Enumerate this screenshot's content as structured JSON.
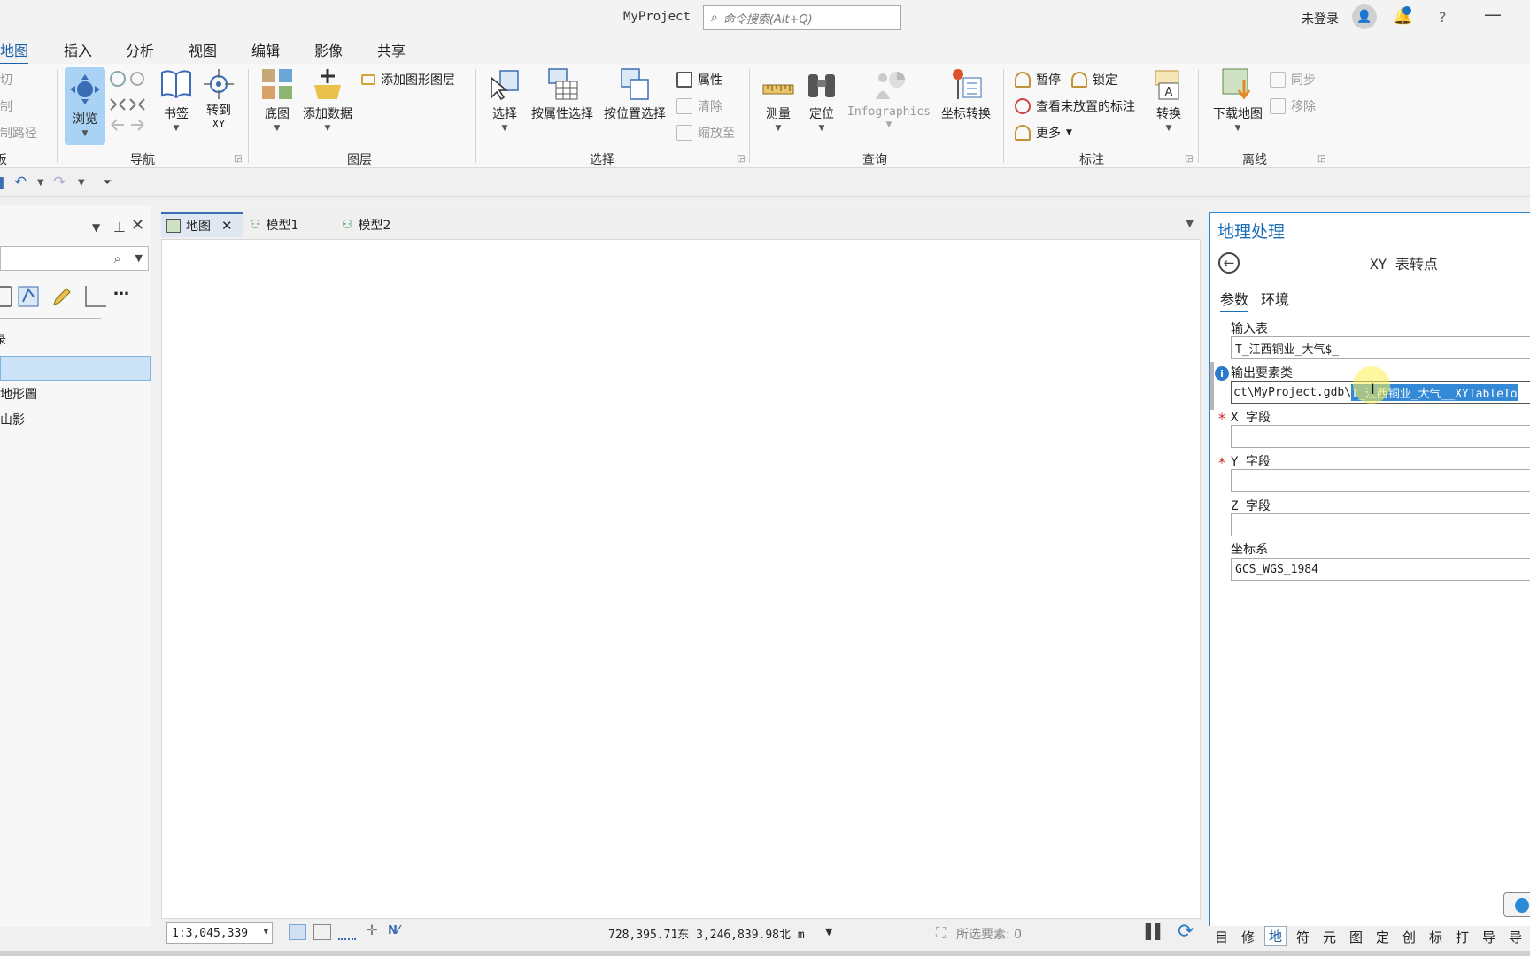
{
  "titlebar": {
    "app_title": "MyProject",
    "search_placeholder": "命令搜索(Alt+Q)",
    "login": "未登录"
  },
  "menu_tabs": [
    "地图",
    "插入",
    "分析",
    "视图",
    "编辑",
    "影像",
    "共享"
  ],
  "ribbon": {
    "clipboard": {
      "cut": "剪切",
      "copy": "复制",
      "copy_path": "复制路径",
      "group": "板"
    },
    "navigate": {
      "explore": "浏览",
      "bookmarks": "书签",
      "goto_xy_line1": "转到",
      "goto_xy_line2": "XY",
      "group": "导航"
    },
    "layer": {
      "basemap": "底图",
      "add_data": "添加数据",
      "add_graphics_layer": "添加图形图层",
      "group": "图层"
    },
    "selection": {
      "select": "选择",
      "select_by_attr": "按属性选择",
      "select_by_loc": "按位置选择",
      "attributes": "属性",
      "clear": "清除",
      "zoom_to": "缩放至",
      "group": "选择"
    },
    "inquiry": {
      "measure": "测量",
      "locate": "定位",
      "infographics": "Infographics",
      "coord_convert": "坐标转换",
      "group": "查询"
    },
    "labeling": {
      "pause": "暂停",
      "lock": "锁定",
      "view_unplaced": "查看未放置的标注",
      "more": "更多",
      "convert": "转换",
      "group": "标注"
    },
    "offline": {
      "download_map": "下载地图",
      "sync": "同步",
      "remove": "移除",
      "group": "离线"
    }
  },
  "contents": {
    "header_partial": "录",
    "layers": [
      "",
      "地形圖",
      "山影"
    ]
  },
  "view_tabs": [
    {
      "label": "地图",
      "active": true
    },
    {
      "label": "模型1",
      "active": false
    },
    {
      "label": "模型2",
      "active": false
    }
  ],
  "statusbar": {
    "scale": "1:3,045,339",
    "coordinates": "728,395.71东 3,246,839.98北 m",
    "selected_features": "所选要素: 0"
  },
  "geoprocessing": {
    "pane_title": "地理处理",
    "tool_name": "XY 表转点",
    "tabs": [
      "参数",
      "环境"
    ],
    "params": {
      "input_table_label": "输入表",
      "input_table_value": "T_江西铜业_大气$_",
      "output_fc_label": "输出要素类",
      "output_fc_value_plain": "ct\\MyProject.gdb\\",
      "output_fc_value_selected": "T_江西铜业_大气__XYTableTo",
      "x_field_label": "X 字段",
      "x_field_value": "",
      "y_field_label": "Y 字段",
      "y_field_value": "",
      "z_field_label": "Z 字段",
      "z_field_value": "",
      "crs_label": "坐标系",
      "crs_value": "GCS_WGS_1984"
    }
  },
  "bottom_tabs": [
    "目",
    "修",
    "地",
    "符",
    "元",
    "图",
    "定",
    "创",
    "标",
    "打",
    "导",
    "导"
  ],
  "colors": {
    "accent": "#1a6fb8",
    "selection_highlight": "#3389d6",
    "active_tool": "#a9d2f5"
  }
}
